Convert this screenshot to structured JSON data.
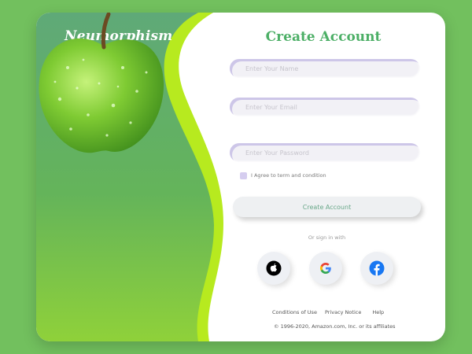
{
  "app": {
    "brand": "Neumorphism"
  },
  "colors": {
    "page_bg": "#72c05e",
    "panel_green": "#5fac74",
    "accent_lime": "#b7ea1f",
    "title_green": "#4caf66",
    "facebook_blue": "#1877f2"
  },
  "form": {
    "title": "Create Account",
    "name_placeholder": "Enter Your Name",
    "email_placeholder": "Enter Your Email",
    "password_placeholder": "Enter Your Password",
    "agree_label": "I Agree to term and condition",
    "agree_checked": false,
    "submit_label": "Create Account",
    "or_text": "Or sign in with"
  },
  "social": [
    {
      "name": "Apple",
      "icon": "apple-icon"
    },
    {
      "name": "Google",
      "icon": "google-icon"
    },
    {
      "name": "Facebook",
      "icon": "facebook-icon"
    }
  ],
  "footer": {
    "links": [
      "Conditions of Use",
      "Privacy Notice",
      "Help"
    ],
    "copyright": "© 1996-2020, Amazon.com, Inc. or its affiliates"
  },
  "images": {
    "hero": "green-apple-with-water-droplets"
  }
}
